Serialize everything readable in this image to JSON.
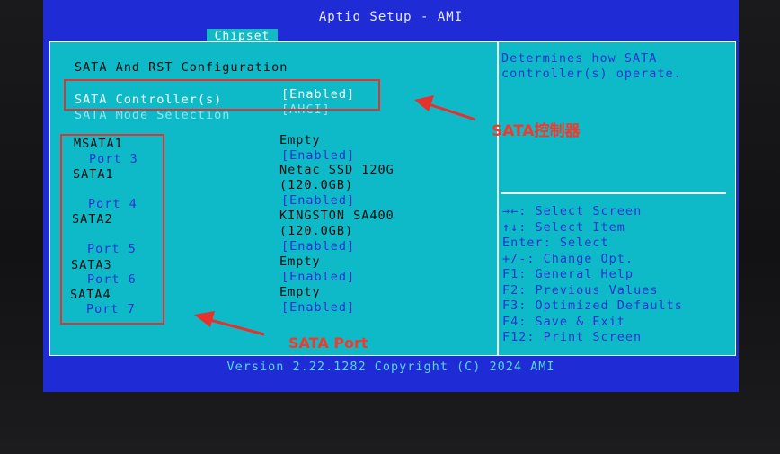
{
  "window": {
    "title": "Aptio Setup - AMI",
    "active_tab": "Chipset"
  },
  "section": {
    "heading": "SATA And RST Configuration"
  },
  "settings": {
    "sata_controller": {
      "label": "SATA Controller(s)",
      "value": "[Enabled]"
    },
    "sata_mode": {
      "label": "SATA Mode Selection",
      "value": "[AHCI]"
    }
  },
  "ports": [
    {
      "device": "MSATA1",
      "status": "Empty",
      "port_label": "Port 3",
      "port_value": "[Enabled]"
    },
    {
      "device": "SATA1",
      "status": "Netac SSD 120G",
      "capacity": "(120.0GB)",
      "port_label": "Port 4",
      "port_value": "[Enabled]"
    },
    {
      "device": "SATA2",
      "status": "KINGSTON SA400",
      "capacity": "(120.0GB)",
      "port_label": "Port 5",
      "port_value": "[Enabled]"
    },
    {
      "device": "SATA3",
      "status": "Empty",
      "port_label": "Port 6",
      "port_value": "[Enabled]"
    },
    {
      "device": "SATA4",
      "status": "Empty",
      "port_label": "Port 7",
      "port_value": "[Enabled]"
    }
  ],
  "help": {
    "line1": "Determines how SATA",
    "line2": "controller(s) operate."
  },
  "keys": [
    {
      "key": "→←:",
      "action": "Select Screen"
    },
    {
      "key": "↑↓:",
      "action": "Select Item"
    },
    {
      "key": "Enter:",
      "action": "Select"
    },
    {
      "key": "+/-:",
      "action": "Change Opt."
    },
    {
      "key": "F1:",
      "action": "General Help"
    },
    {
      "key": "F2:",
      "action": "Previous Values"
    },
    {
      "key": "F3:",
      "action": "Optimized Defaults"
    },
    {
      "key": "F4:",
      "action": "Save & Exit"
    },
    {
      "key": "F12:",
      "action": "Print Screen"
    }
  ],
  "footer": {
    "version": "Version 2.22.1282 Copyright (C) 2024 AMI"
  },
  "annotations": {
    "controller_note": "SATA控制器",
    "port_note": "SATA Port"
  },
  "colors": {
    "bios_blue": "#1f2bd4",
    "bios_cyan": "#0fbac8",
    "annotation_red": "#e8302c"
  }
}
